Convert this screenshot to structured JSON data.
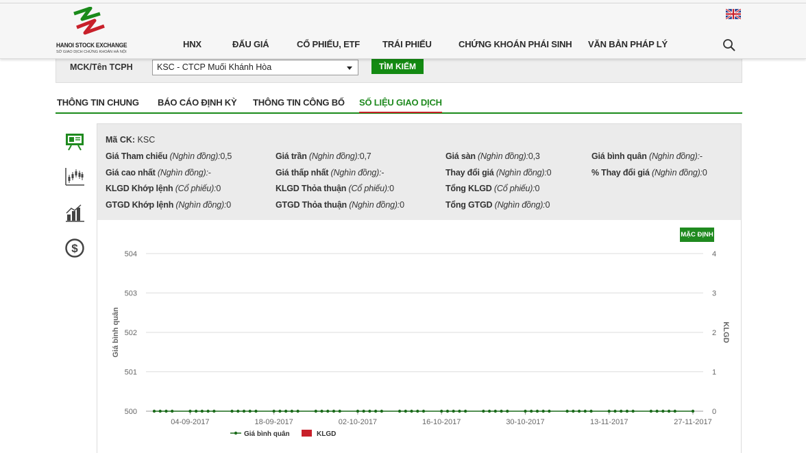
{
  "header": {
    "logo_name": "HANOI STOCK EXCHANGE",
    "logo_sub": "SỞ GIAO DỊCH CHỨNG KHOÁN HÀ NỘI",
    "nav": [
      "HNX",
      "ĐẤU GIÁ",
      "CỔ PHIẾU, ETF",
      "TRÁI PHIẾU",
      "CHỨNG KHOÁN PHÁI SINH",
      "VĂN BẢN PHÁP LÝ"
    ],
    "language_icon": "uk-flag-icon",
    "search_icon": "search-icon"
  },
  "search": {
    "label": "MCK/Tên TCPH",
    "selected": "KSC - CTCP Muối Khánh Hòa",
    "button": "TÌM KIẾM"
  },
  "tabs": [
    "THÔNG TIN CHUNG",
    "BÁO CÁO ĐỊNH KỲ",
    "THÔNG TIN CÔNG BỐ",
    "SỐ LIỆU GIAO DỊCH"
  ],
  "active_tab": "SỐ LIỆU GIAO DỊCH",
  "side_icons": [
    "presentation-board-icon",
    "candlestick-chart-icon",
    "bar-chart-icon",
    "dollar-circle-icon"
  ],
  "info": {
    "mack_label": "Mã CK:",
    "mack_value": "KSC",
    "fields": [
      {
        "label": "Giá Tham chiếu",
        "unit": "(Nghìn đồng):",
        "value": "0,5"
      },
      {
        "label": "Giá trần",
        "unit": "(Nghìn đồng):",
        "value": "0,7"
      },
      {
        "label": "Giá sàn",
        "unit": "(Nghìn đồng):",
        "value": "0,3"
      },
      {
        "label": "Giá bình quân",
        "unit": "(Nghìn đồng):",
        "value": "-"
      },
      {
        "label": "Giá cao nhất",
        "unit": "(Nghìn đồng):",
        "value": "-"
      },
      {
        "label": "Giá thấp nhất",
        "unit": "(Nghìn đồng):",
        "value": "-"
      },
      {
        "label": "Thay đổi giá",
        "unit": "(Nghìn đồng):",
        "value": "0"
      },
      {
        "label": "% Thay đổi giá",
        "unit": "(Nghìn đồng):",
        "value": "0"
      },
      {
        "label": "KLGD Khớp lệnh",
        "unit": "(Cổ phiếu):",
        "value": "0"
      },
      {
        "label": "KLGD Thỏa thuận",
        "unit": "(Cổ phiếu):",
        "value": "0"
      },
      {
        "label": "Tổng KLGD",
        "unit": "(Cổ phiếu):",
        "value": "0"
      },
      {
        "label": "GTGD Khớp lệnh",
        "unit": "(Nghìn đồng):",
        "value": "0"
      },
      {
        "label": "GTGD Thỏa thuận",
        "unit": "(Nghìn đồng):",
        "value": "0"
      },
      {
        "label": "Tổng GTGD",
        "unit": "(Nghìn đồng):",
        "value": "0"
      }
    ]
  },
  "chart_button": "MẶC ĐỊNH",
  "colors": {
    "green": "#138a12",
    "red": "#c8202a",
    "line": "#1a6a1a"
  },
  "chart_data": {
    "type": "line",
    "ylabel": "Giá bình quân",
    "y2label": "KLGD",
    "ylim": [
      500,
      504
    ],
    "y2lim": [
      0,
      4
    ],
    "yticks": [
      "500",
      "501",
      "502",
      "503",
      "504"
    ],
    "y2ticks": [
      "0",
      "1",
      "2",
      "3",
      "4"
    ],
    "xtick_labels": [
      "04-09-2017",
      "18-09-2017",
      "02-10-2017",
      "16-10-2017",
      "30-10-2017",
      "13-11-2017",
      "27-11-2017"
    ],
    "x_start": "2017-08-29",
    "x_end": "2017-11-27",
    "series": [
      {
        "name": "Giá bình quân",
        "color": "#1a6a1a",
        "values_note": "constant at axis minimum",
        "value": 500
      },
      {
        "name": "KLGD",
        "color": "#c8202a",
        "value": 0
      }
    ],
    "legend": "bottom-center",
    "grid": true
  }
}
